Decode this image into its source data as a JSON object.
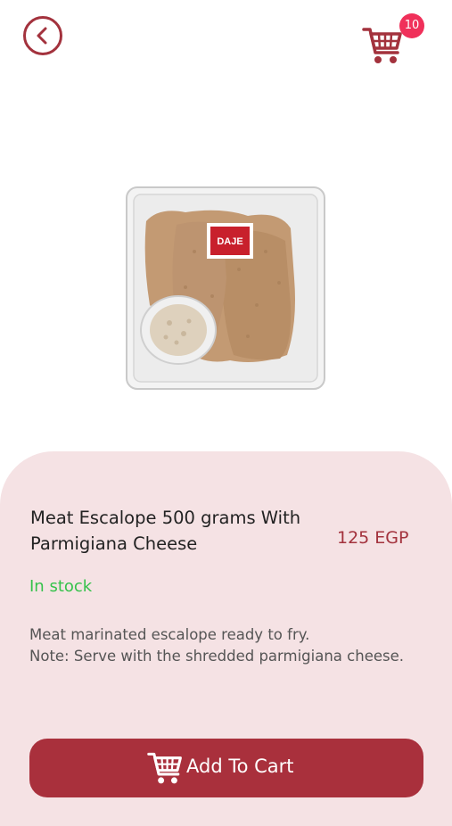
{
  "header": {
    "back_icon": "chevron-left-icon",
    "cart_icon": "shopping-cart-icon",
    "cart_count": "10"
  },
  "product": {
    "image_logo_text": "DAJE",
    "title": "Meat Escalope 500 grams With Parmigiana Cheese",
    "price": "125 EGP",
    "stock": "In stock",
    "description": "Meat marinated escalope ready to fry.\nNote: Serve with the shredded parmigiana cheese."
  },
  "actions": {
    "add_to_cart_label": "Add To Cart"
  },
  "colors": {
    "accent": "#a9303c",
    "stock": "#35c24b",
    "panel": "#f5e2e4",
    "badge": "#f0305a"
  }
}
